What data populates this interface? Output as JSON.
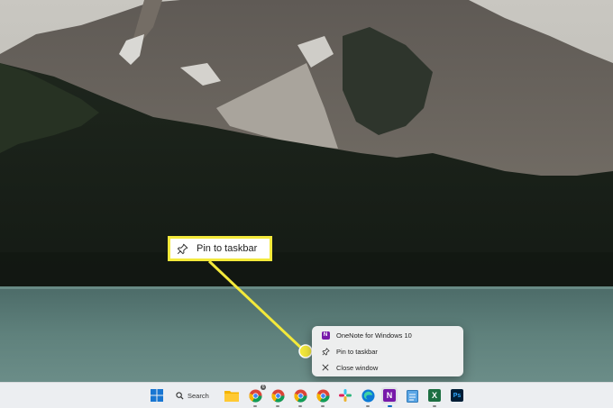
{
  "taskbar": {
    "search_label": "Search",
    "apps": [
      {
        "icon": "windows-start-icon"
      },
      {
        "icon": "file-explorer-icon"
      },
      {
        "icon": "chrome-icon",
        "badge": "6"
      },
      {
        "icon": "chrome-icon"
      },
      {
        "icon": "chrome-icon"
      },
      {
        "icon": "chrome-icon"
      },
      {
        "icon": "slack-icon"
      },
      {
        "icon": "edge-icon"
      },
      {
        "icon": "onenote-icon",
        "label": "N"
      },
      {
        "icon": "notepad-icon"
      },
      {
        "icon": "excel-icon",
        "label": "X"
      },
      {
        "icon": "photoshop-icon",
        "label": "Ps"
      }
    ]
  },
  "jumplist": {
    "app_name": "OneNote for Windows 10",
    "pin_label": "Pin to taskbar",
    "close_label": "Close window"
  },
  "callout": {
    "label": "Pin to taskbar",
    "accent_color": "#f3e93b"
  },
  "colors": {
    "onenote": "#7719aa",
    "excel": "#1d6f42",
    "photoshop": "#001e36",
    "edge": "#0c7ad6"
  }
}
